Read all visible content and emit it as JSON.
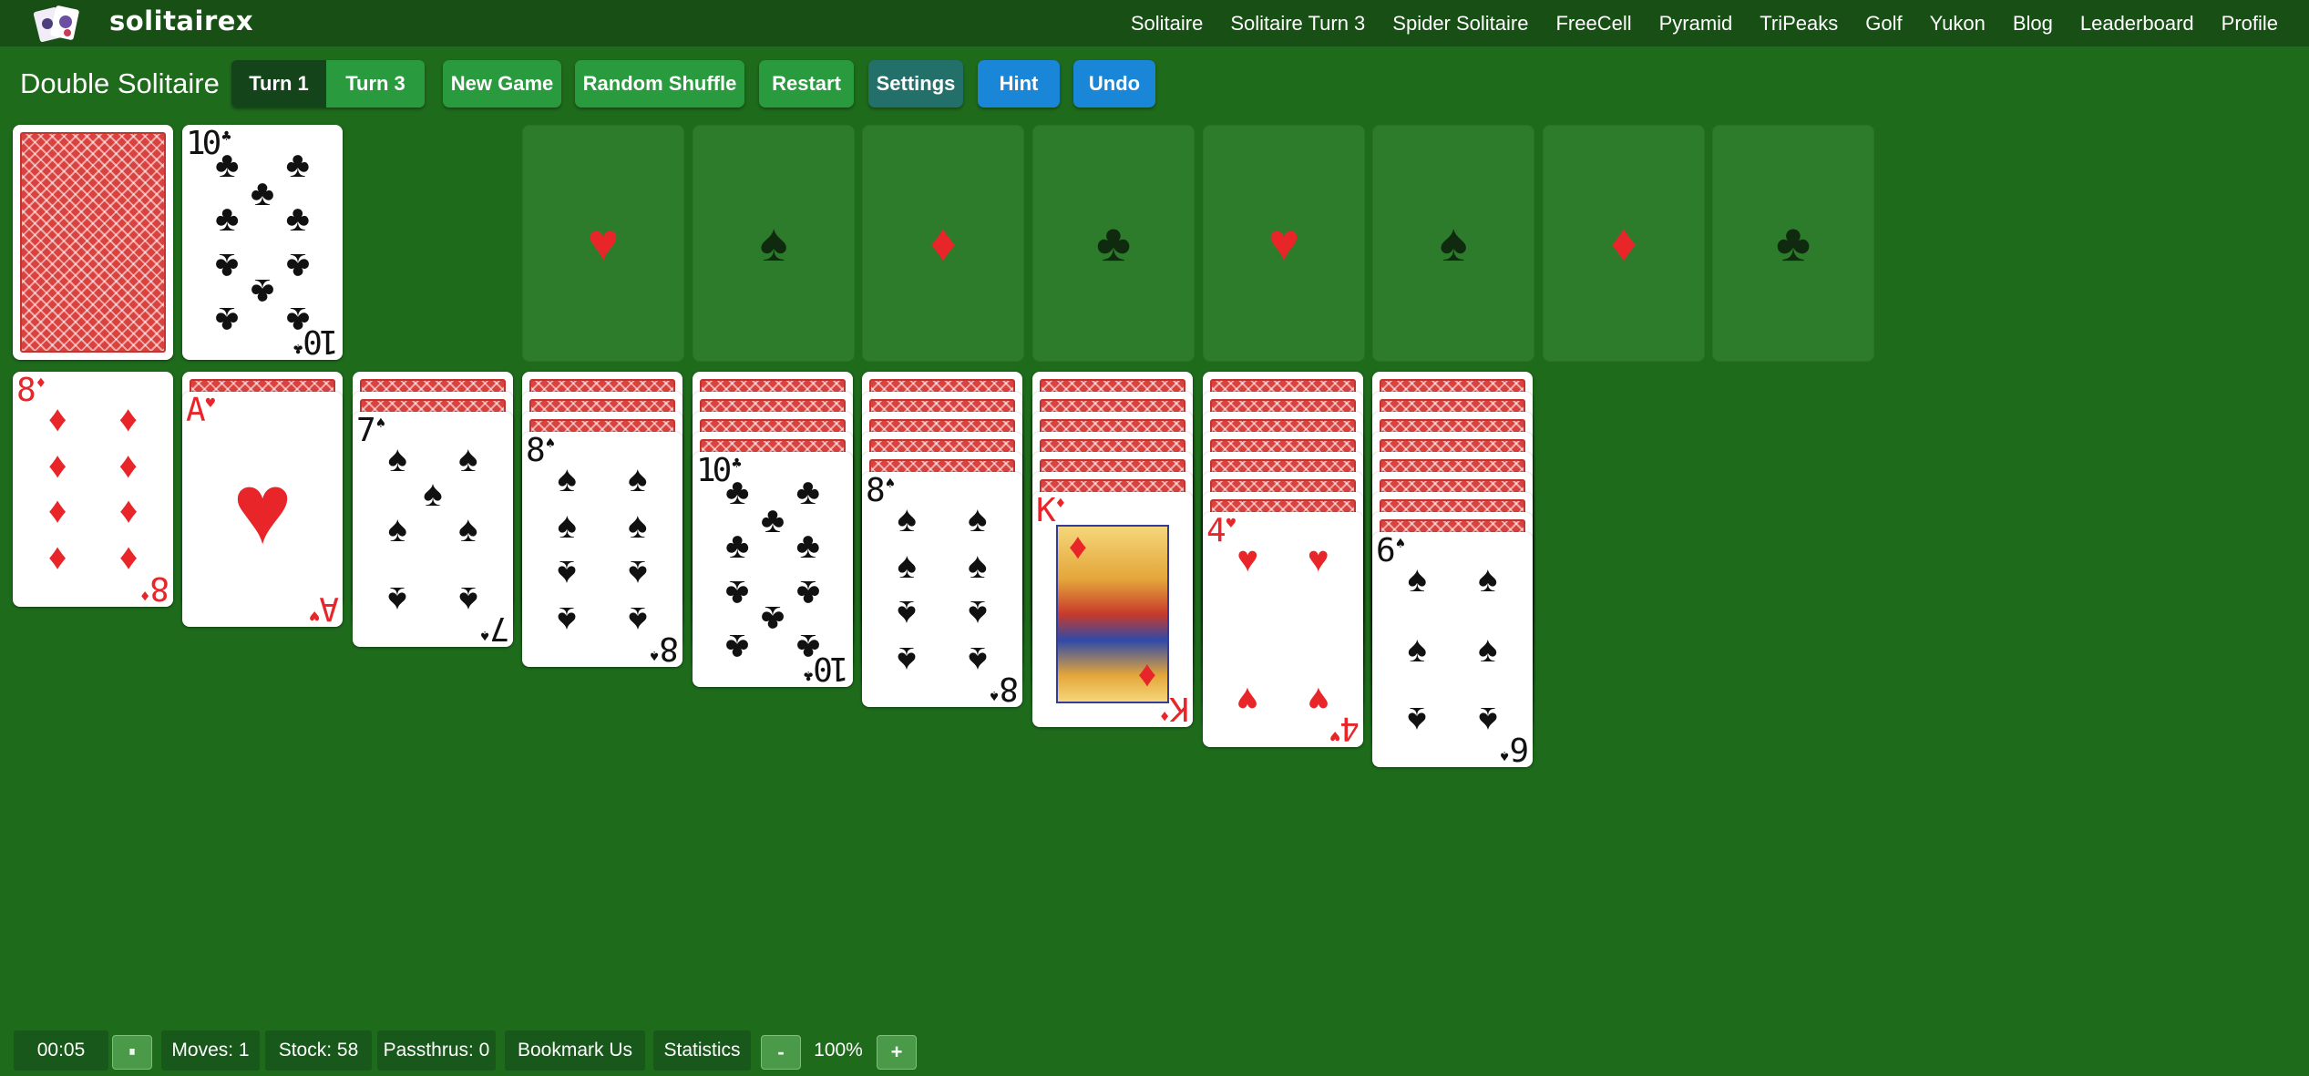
{
  "app": {
    "brand": "solitairex"
  },
  "nav": [
    "Solitaire",
    "Solitaire Turn 3",
    "Spider Solitaire",
    "FreeCell",
    "Pyramid",
    "TriPeaks",
    "Golf",
    "Yukon",
    "Blog",
    "Leaderboard",
    "Profile"
  ],
  "toolbar": {
    "title": "Double Solitaire",
    "turn1": "Turn 1",
    "turn3": "Turn 3",
    "active_turn": "Turn 1",
    "new_game": "New Game",
    "random_shuffle": "Random Shuffle",
    "restart": "Restart",
    "settings": "Settings",
    "hint": "Hint",
    "undo": "Undo"
  },
  "stock": {
    "face_down": true
  },
  "waste": {
    "top": {
      "rank": "10",
      "suit": "♣",
      "color": "black"
    }
  },
  "foundations": [
    {
      "suit": "♥",
      "color": "red"
    },
    {
      "suit": "♠",
      "color": "black"
    },
    {
      "suit": "♦",
      "color": "red"
    },
    {
      "suit": "♣",
      "color": "black"
    },
    {
      "suit": "♥",
      "color": "red"
    },
    {
      "suit": "♠",
      "color": "black"
    },
    {
      "suit": "♦",
      "color": "red"
    },
    {
      "suit": "♣",
      "color": "black"
    }
  ],
  "tableau": [
    {
      "hidden": 0,
      "top": {
        "rank": "8",
        "suit": "♦",
        "color": "red"
      }
    },
    {
      "hidden": 1,
      "top": {
        "rank": "A",
        "suit": "♥",
        "color": "red"
      }
    },
    {
      "hidden": 2,
      "top": {
        "rank": "7",
        "suit": "♠",
        "color": "black"
      }
    },
    {
      "hidden": 3,
      "top": {
        "rank": "8",
        "suit": "♠",
        "color": "black"
      }
    },
    {
      "hidden": 4,
      "top": {
        "rank": "10",
        "suit": "♣",
        "color": "black"
      }
    },
    {
      "hidden": 5,
      "top": {
        "rank": "8",
        "suit": "♠",
        "color": "black"
      }
    },
    {
      "hidden": 6,
      "top": {
        "rank": "K",
        "suit": "♦",
        "color": "red"
      }
    },
    {
      "hidden": 7,
      "top": {
        "rank": "4",
        "suit": "♥",
        "color": "red"
      }
    },
    {
      "hidden": 8,
      "top": {
        "rank": "6",
        "suit": "♠",
        "color": "black"
      }
    }
  ],
  "status": {
    "timer": "00:05",
    "pause_icon": "⏸",
    "moves": "Moves: 1",
    "stock": "Stock: 58",
    "passthrus": "Passthrus: 0",
    "bookmark": "Bookmark Us",
    "statistics": "Statistics",
    "zoom_out": "-",
    "zoom": "100%",
    "zoom_in": "+"
  }
}
